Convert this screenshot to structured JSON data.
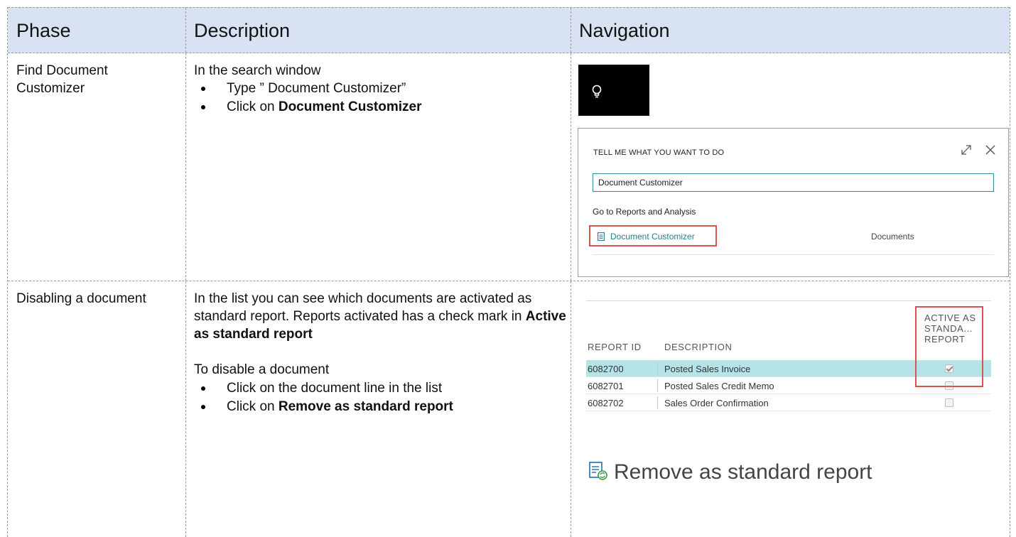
{
  "table": {
    "headers": {
      "phase": "Phase",
      "description": "Description",
      "navigation": "Navigation"
    },
    "rows": [
      {
        "phase": "Find Document Customizer",
        "intro": "In the search window",
        "steps": [
          {
            "text": "Type ” Document Customizer”",
            "bold": ""
          },
          {
            "text": "Click on ",
            "bold": "Document Customizer"
          }
        ]
      },
      {
        "phase": "Disabling a document",
        "para_text": "In the list you can see which documents are activated as standard report. Reports activated has a check mark in ",
        "para_bold": "Active as standard report",
        "intro2": "To disable a document",
        "steps": [
          {
            "text": "Click on the document line in the list",
            "bold": ""
          },
          {
            "text": "Click on ",
            "bold": "Remove as standard report"
          }
        ]
      }
    ]
  },
  "tell_me": {
    "title": "TELL ME WHAT YOU WANT TO DO",
    "input_value": "Document Customizer",
    "group_label": "Go to Reports and Analysis",
    "result_label": "Document Customizer",
    "result_category": "Documents",
    "icons": {
      "tile": "lightbulb-icon",
      "expand": "expand-icon",
      "close": "close-icon",
      "result": "document-icon"
    }
  },
  "report_list": {
    "headers": {
      "id": "REPORT ID",
      "description": "DESCRIPTION",
      "active_line1": "ACTIVE AS",
      "active_line2": "STANDA...",
      "active_line3": "REPORT"
    },
    "rows": [
      {
        "id": "6082700",
        "description": "Posted Sales Invoice",
        "active": true,
        "selected": true
      },
      {
        "id": "6082701",
        "description": "Posted Sales Credit Memo",
        "active": false,
        "selected": false
      },
      {
        "id": "6082702",
        "description": "Sales Order Confirmation",
        "active": false,
        "selected": false
      }
    ],
    "action_label": "Remove as standard report",
    "action_icon": "remove-report-icon"
  },
  "colors": {
    "header_bg": "#d9e2f3",
    "highlight_red": "#d9534f",
    "selected_row": "#b4e4e8",
    "link_teal": "#1f7f8c"
  }
}
